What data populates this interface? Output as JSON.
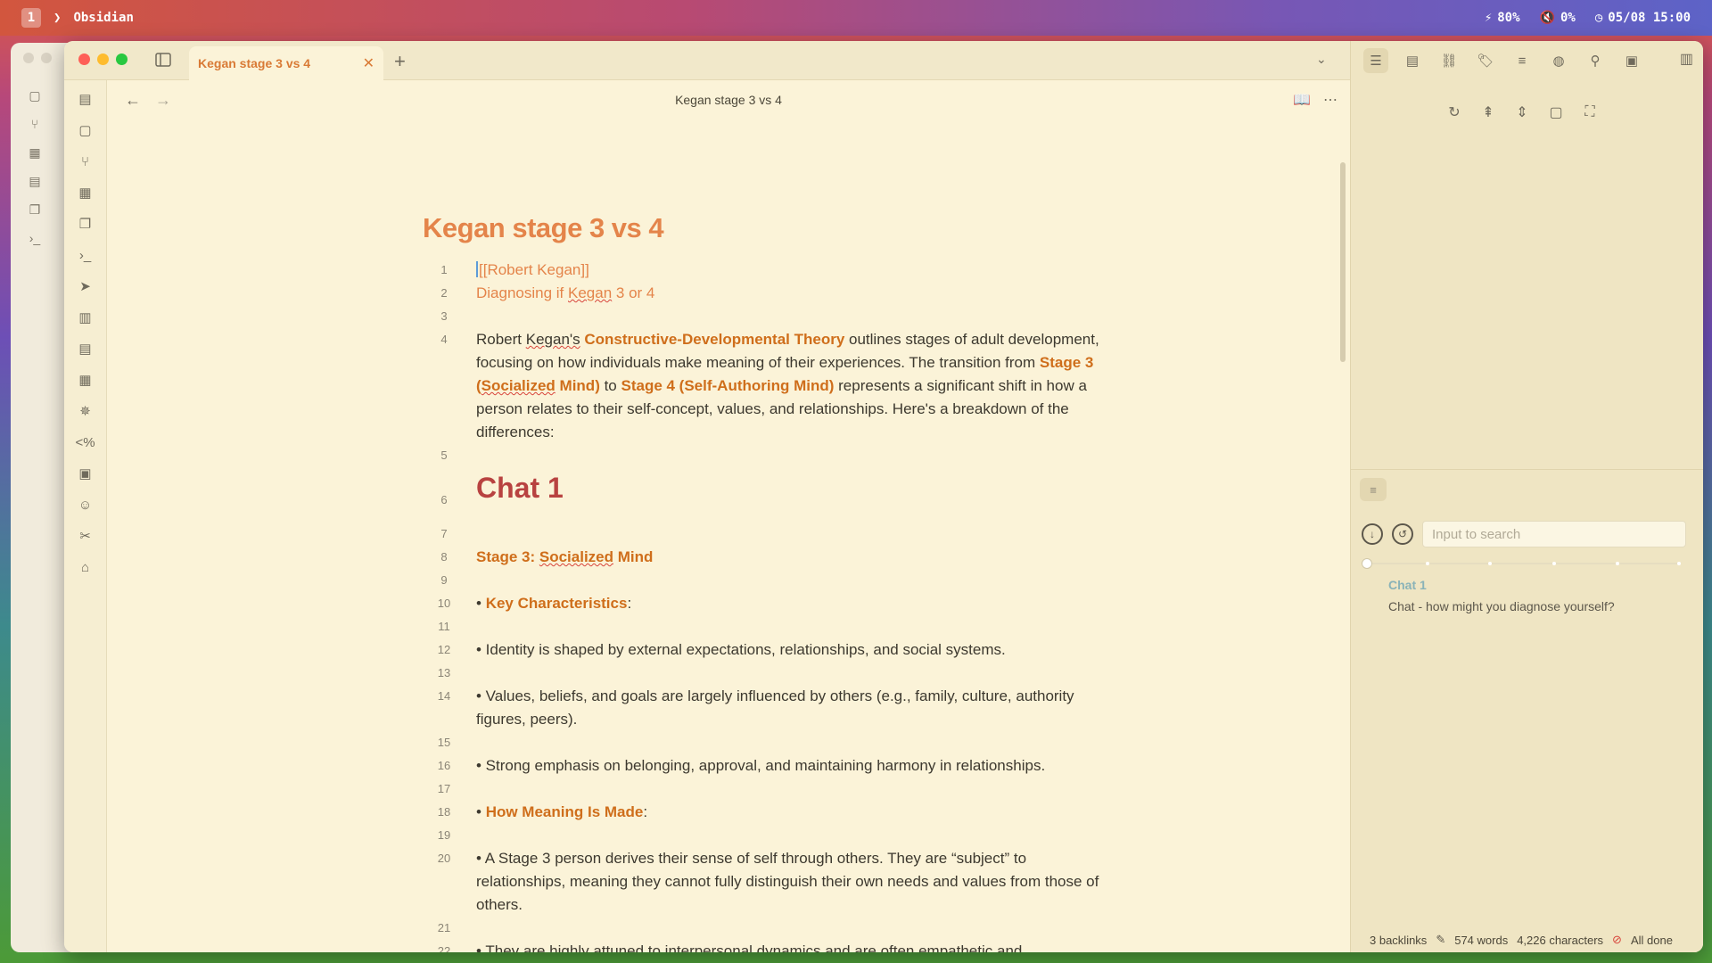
{
  "menubar": {
    "workspace": "1",
    "app": "Obsidian",
    "battery": "80%",
    "volume": "0%",
    "datetime": "05/08 15:00"
  },
  "tab": {
    "title": "Kegan stage 3 vs 4"
  },
  "view": {
    "title": "Kegan stage 3 vs 4"
  },
  "document": {
    "title": "Kegan stage 3 vs 4",
    "lines": {
      "l1": "[[Robert Kegan]]",
      "l2a": "Diagnosing if ",
      "l2b": "Kegan",
      "l2c": " 3 or 4",
      "l4a": "Robert ",
      "l4b": "Kegan's",
      "l4c": " ",
      "l4d": "Constructive-Developmental Theory",
      "l4e": " outlines stages of adult development, focusing on how individuals make meaning of their experiences. The transition from ",
      "l4f": "Stage 3 (",
      "l4g": "Socialized",
      "l4h": " Mind)",
      "l4i": " to ",
      "l4j": "Stage 4 (Self-Authoring Mind)",
      "l4k": " represents a significant shift in how a person relates to their self-concept, values, and relationships. Here's a breakdown of the differences:",
      "l6": "Chat 1",
      "l8a": "Stage 3: ",
      "l8b": "Socialized",
      "l8c": " Mind",
      "l10a": "• ",
      "l10b": "Key Characteristics",
      "l10c": ":",
      "l12": "• Identity is shaped by external expectations, relationships, and social systems.",
      "l14": "• Values, beliefs, and goals are largely influenced by others (e.g., family, culture, authority figures, peers).",
      "l16": "• Strong emphasis on belonging, approval, and maintaining harmony in relationships.",
      "l18a": "• ",
      "l18b": "How Meaning Is Made",
      "l18c": ":",
      "l20": "• A Stage 3 person derives their sense of self through others. They are “subject” to relationships, meaning they cannot fully distinguish their own needs and values from those of others.",
      "l22": "• They are highly attuned to interpersonal dynamics and are often empathetic and cooperative, but they may struggle with asserting themselves or navigating conflicting"
    },
    "line_numbers": [
      "1",
      "2",
      "3",
      "4",
      "5",
      "6",
      "7",
      "8",
      "9",
      "10",
      "11",
      "12",
      "13",
      "14",
      "15",
      "16",
      "17",
      "18",
      "19",
      "20",
      "21",
      "22"
    ]
  },
  "right_panel": {
    "search_placeholder": "Input to search",
    "result_title": "Chat 1",
    "result_text": "Chat - how might you diagnose yourself?"
  },
  "status": {
    "backlinks": "3 backlinks",
    "words": "574 words",
    "characters": "4,226 characters",
    "sync": "All done"
  }
}
